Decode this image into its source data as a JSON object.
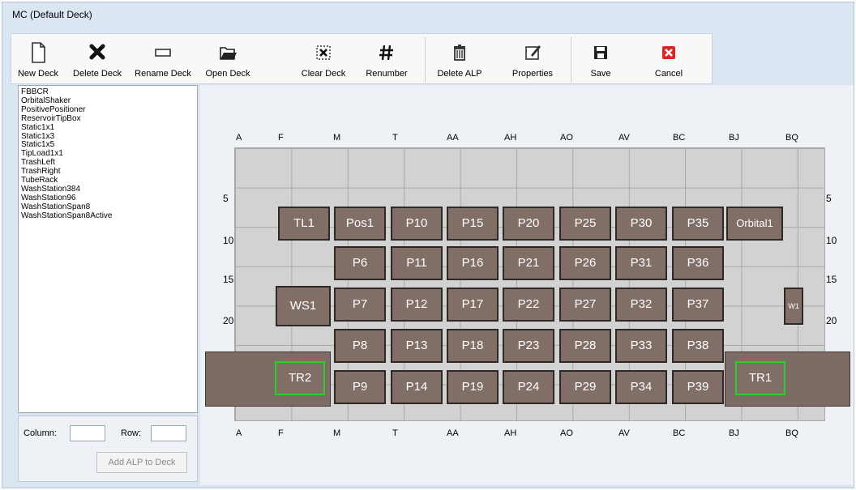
{
  "window": {
    "title": "MC (Default Deck)"
  },
  "toolbar": {
    "new_deck": "New Deck",
    "delete_deck": "Delete Deck",
    "rename_deck": "Rename Deck",
    "open_deck": "Open Deck",
    "clear_deck": "Clear Deck",
    "renumber": "Renumber",
    "delete_alp": "Delete ALP",
    "properties": "Properties",
    "save": "Save",
    "cancel": "Cancel"
  },
  "alp_list": [
    "FBBCR",
    "OrbitalShaker",
    "PositivePositioner",
    "ReservoirTipBox",
    "Static1x1",
    "Static1x3",
    "Static1x5",
    "TipLoad1x1",
    "TrashLeft",
    "TrashRight",
    "TubeRack",
    "WashStation384",
    "WashStation96",
    "WashStationSpan8",
    "WashStationSpan8Active"
  ],
  "placement": {
    "column_label": "Column:",
    "row_label": "Row:",
    "column_value": "",
    "row_value": "",
    "add_button": "Add ALP to Deck"
  },
  "deck": {
    "column_labels": [
      "A",
      "F",
      "M",
      "T",
      "AA",
      "AH",
      "AO",
      "AV",
      "BC",
      "BJ",
      "BQ"
    ],
    "row_labels": [
      "5",
      "10",
      "15",
      "20"
    ],
    "positions": {
      "tl1": "TL1",
      "pos1": "Pos1",
      "orbital1": "Orbital1",
      "ws1": "WS1",
      "w1": "W1",
      "tr1": "TR1",
      "tr2": "TR2",
      "p6": "P6",
      "p7": "P7",
      "p8": "P8",
      "p9": "P9",
      "p10": "P10",
      "p11": "P11",
      "p12": "P12",
      "p13": "P13",
      "p14": "P14",
      "p15": "P15",
      "p16": "P16",
      "p17": "P17",
      "p18": "P18",
      "p19": "P19",
      "p20": "P20",
      "p21": "P21",
      "p22": "P22",
      "p23": "P23",
      "p24": "P24",
      "p25": "P25",
      "p26": "P26",
      "p27": "P27",
      "p28": "P28",
      "p29": "P29",
      "p30": "P30",
      "p31": "P31",
      "p32": "P32",
      "p33": "P33",
      "p34": "P34",
      "p35": "P35",
      "p36": "P36",
      "p37": "P37",
      "p38": "P38",
      "p39": "P39"
    }
  }
}
